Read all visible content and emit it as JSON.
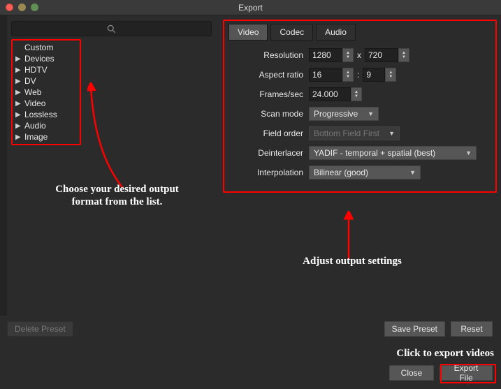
{
  "window": {
    "title": "Export"
  },
  "sidebar": {
    "items": [
      {
        "label": "Custom"
      },
      {
        "label": "Devices"
      },
      {
        "label": "HDTV"
      },
      {
        "label": "DV"
      },
      {
        "label": "Web"
      },
      {
        "label": "Video"
      },
      {
        "label": "Lossless"
      },
      {
        "label": "Audio"
      },
      {
        "label": "Image"
      }
    ]
  },
  "tabs": {
    "video": "Video",
    "codec": "Codec",
    "audio": "Audio"
  },
  "settings": {
    "resolution_label": "Resolution",
    "resolution_w": "1280",
    "resolution_h": "720",
    "resolution_sep": "x",
    "aspect_label": "Aspect ratio",
    "aspect_w": "16",
    "aspect_h": "9",
    "aspect_sep": ":",
    "fps_label": "Frames/sec",
    "fps_value": "24.000",
    "scan_label": "Scan mode",
    "scan_value": "Progressive",
    "field_label": "Field order",
    "field_value": "Bottom Field First",
    "deint_label": "Deinterlacer",
    "deint_value": "YADIF - temporal + spatial (best)",
    "interp_label": "Interpolation",
    "interp_value": "Bilinear (good)"
  },
  "buttons": {
    "delete_preset": "Delete Preset",
    "save_preset": "Save Preset",
    "reset": "Reset",
    "close": "Close",
    "export_file": "Export File"
  },
  "annotations": {
    "left": "Choose your desired output format from the list.",
    "right": "Adjust output settings",
    "export": "Click to export videos"
  }
}
